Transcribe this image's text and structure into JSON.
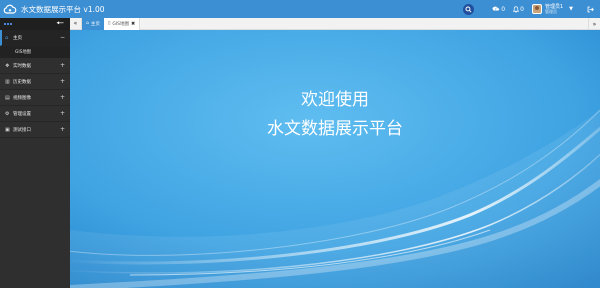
{
  "app": {
    "title": "水文数据展示平台 v1.00"
  },
  "topbar": {
    "messages_count": "0",
    "alerts_count": "0",
    "user_name": "管理员1",
    "user_role": "管理员"
  },
  "sidebar": {
    "items": [
      {
        "label": "主页",
        "expand": "−",
        "icon": "home-icon"
      },
      {
        "label": "实时数据",
        "expand": "+",
        "icon": "cubes-icon"
      },
      {
        "label": "历史数据",
        "expand": "+",
        "icon": "chart-icon"
      },
      {
        "label": "视频图像",
        "expand": "+",
        "icon": "film-icon"
      },
      {
        "label": "管理设置",
        "expand": "+",
        "icon": "cogs-icon"
      },
      {
        "label": "测试接口",
        "expand": "+",
        "icon": "document-icon"
      }
    ],
    "sub_items": [
      {
        "label": "GIS地图"
      }
    ]
  },
  "tabs": {
    "home_label": "主页",
    "gis_label": "GIS地图"
  },
  "main": {
    "welcome_line1": "欢迎使用",
    "welcome_line2": "水文数据展示平台"
  },
  "colors": {
    "topbar": "#3d8fd3",
    "sidebar": "#2f2f2f",
    "content_light": "#57b4ea",
    "content_dark": "#1f86cc"
  }
}
